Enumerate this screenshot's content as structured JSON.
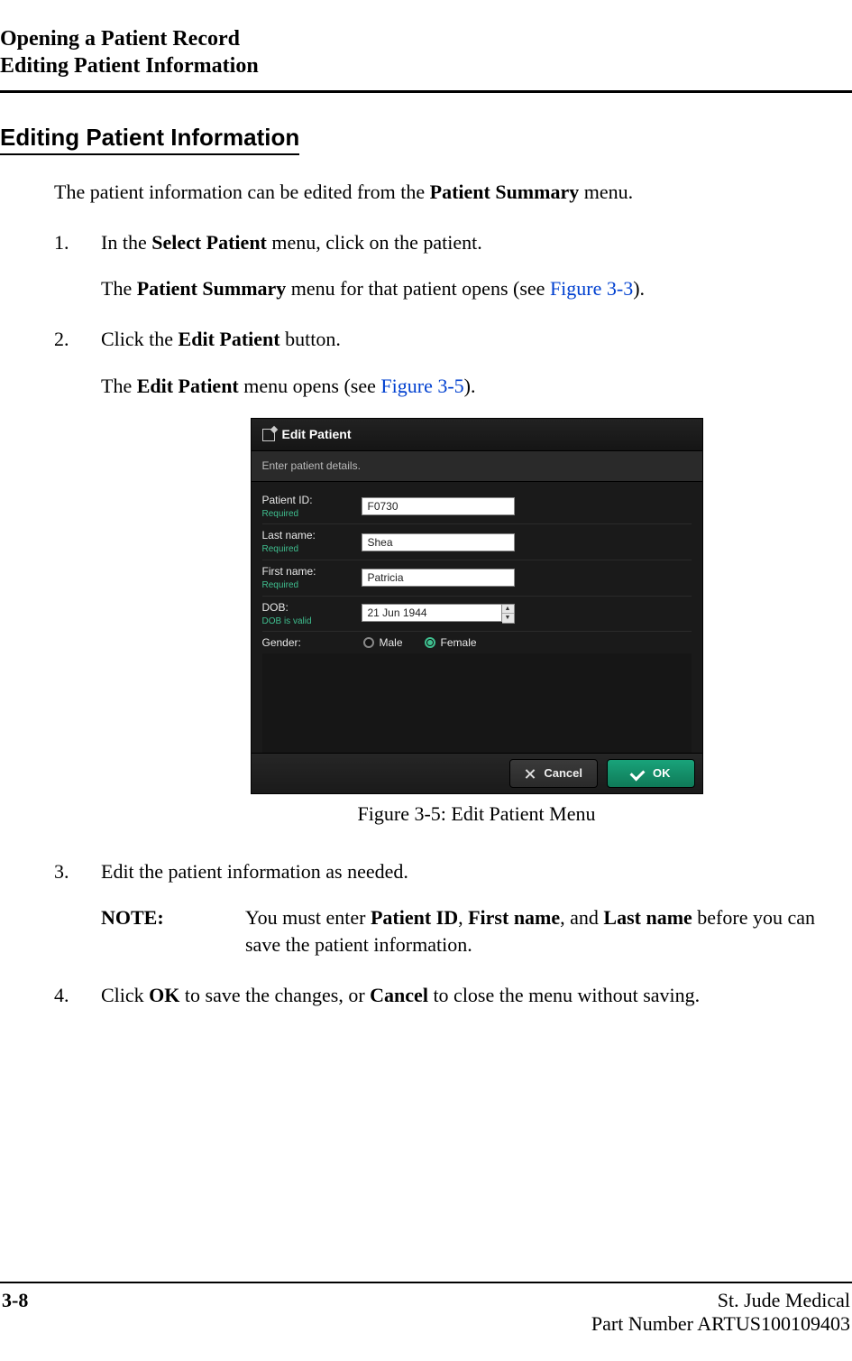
{
  "header": {
    "line1": "Opening a Patient Record",
    "line2": "Editing Patient Information"
  },
  "section_title": "Editing Patient Information",
  "intro": {
    "prefix": "The patient information can be edited from the ",
    "bold": "Patient Summary",
    "suffix": " menu."
  },
  "steps": {
    "s1": {
      "num": "1.",
      "l1_a": "In the ",
      "l1_bold": "Select Patient",
      "l1_b": " menu, click on the patient.",
      "l2_a": "The ",
      "l2_bold": "Patient Summary",
      "l2_b": " menu for that patient opens (see ",
      "l2_link": "Figure 3-3",
      "l2_c": ")."
    },
    "s2": {
      "num": "2.",
      "l1_a": "Click the ",
      "l1_bold": "Edit Patient",
      "l1_b": " button.",
      "l2_a": "The ",
      "l2_bold": "Edit Patient",
      "l2_b": " menu opens (see ",
      "l2_link": "Figure 3-5",
      "l2_c": ")."
    },
    "s3": {
      "num": "3.",
      "l1": "Edit the patient information as needed.",
      "note_label": "NOTE:",
      "note_a": "You must enter ",
      "note_b1": "Patient ID",
      "note_c1": ", ",
      "note_b2": "First name",
      "note_c2": ", and ",
      "note_b3": "Last name",
      "note_c3": " before you can save the patient information."
    },
    "s4": {
      "num": "4.",
      "l1_a": "Click ",
      "l1_b1": "OK",
      "l1_b": " to save the changes, or ",
      "l1_b2": "Cancel",
      "l1_c": " to close the menu without saving."
    }
  },
  "figure": {
    "caption": "Figure 3-5:  Edit Patient Menu",
    "dialog": {
      "title": "Edit Patient",
      "subtitle": "Enter patient details.",
      "rows": {
        "patient_id": {
          "label": "Patient ID:",
          "hint": "Required",
          "value": "F0730"
        },
        "last_name": {
          "label": "Last name:",
          "hint": "Required",
          "value": "Shea"
        },
        "first_name": {
          "label": "First name:",
          "hint": "Required",
          "value": "Patricia"
        },
        "dob": {
          "label": "DOB:",
          "hint": "DOB is valid",
          "value": "21 Jun 1944"
        },
        "gender": {
          "label": "Gender:",
          "male": "Male",
          "female": "Female",
          "selected": "female"
        }
      },
      "buttons": {
        "cancel": "Cancel",
        "ok": "OK"
      }
    }
  },
  "footer": {
    "page": "3-8",
    "company": "St. Jude Medical",
    "part": "Part Number ARTUS100109403"
  }
}
